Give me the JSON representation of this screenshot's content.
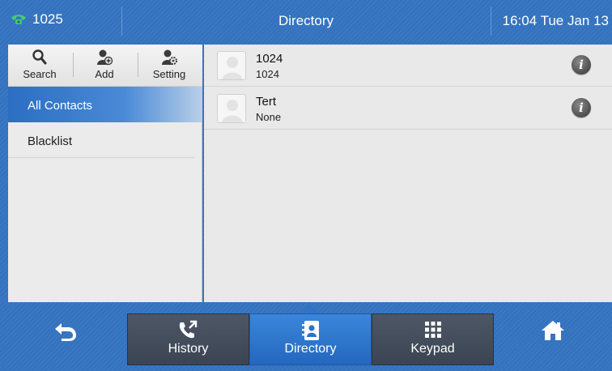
{
  "status_bar": {
    "line_icon": "phone-handset-icon",
    "account": "1025",
    "title": "Directory",
    "datetime": "16:04 Tue Jan 13"
  },
  "toolbar": {
    "search_label": "Search",
    "add_label": "Add",
    "setting_label": "Setting"
  },
  "groups": [
    {
      "label": "All Contacts",
      "active": true
    },
    {
      "label": "Blacklist",
      "active": false
    }
  ],
  "contacts": [
    {
      "name": "1024",
      "number": "1024"
    },
    {
      "name": "Tert",
      "number": "None"
    }
  ],
  "nav": {
    "back_icon": "back-arrow-icon",
    "history_label": "History",
    "directory_label": "Directory",
    "keypad_label": "Keypad",
    "home_icon": "home-icon"
  },
  "colors": {
    "accent": "#2b6ec2",
    "status_icon": "#3fd06a",
    "active_tab": "#2d73c8"
  }
}
